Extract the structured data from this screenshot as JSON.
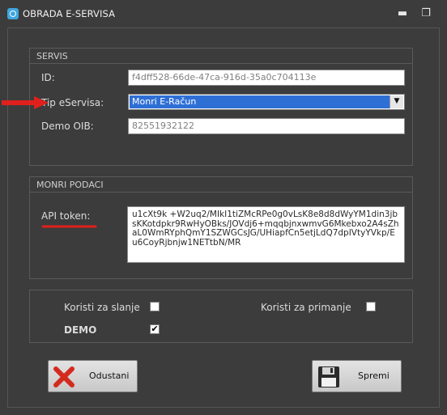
{
  "window": {
    "title": "OBRADA E-SERVISA",
    "minimize_glyph": "▬",
    "maximize_glyph": "❐"
  },
  "servis": {
    "title": "SERVIS",
    "id_label": "ID:",
    "id_value": "f4dff528-66de-47ca-916d-35a0c704113e",
    "tip_label": "Tip eServisa:",
    "tip_value": "Monri E-Račun",
    "oib_label": "Demo OIB:",
    "oib_value": "82551932122"
  },
  "monri": {
    "title": "MONRI PODACI",
    "api_label": "API token:",
    "api_value": "u1cXt9k +W2uq2/MIkI1tiZMcRPe0g0vLsK8e8d8dWyYM1din3jbsKKotdpkr9RwHyOBks/JOVdj6+mqqbjnxwmvG6Mkebxo2A4sZhaL0WmRYphQmY1SZWGCsJG/UHiapfCn5etjLdQ7dpIVtyYVkp/Eu6CoyRjbnjw1NETtbN/MR"
  },
  "options": {
    "slanje_label": "Koristi za slanje",
    "slanje_checked": false,
    "primanje_label": "Koristi za primanje",
    "primanje_checked": false,
    "demo_label": "DEMO",
    "demo_checked": true,
    "check_glyph": "✔"
  },
  "buttons": {
    "cancel_label": "Odustani",
    "save_label": "Spremi"
  },
  "icons": {
    "app": "app-icon",
    "cancel": "red-x-icon",
    "save": "floppy-disk-icon",
    "annotation": "red-arrow-icon"
  },
  "colors": {
    "accent_select": "#2e6fd6",
    "annotation": "#e0201c",
    "background": "#3c3c3c"
  }
}
